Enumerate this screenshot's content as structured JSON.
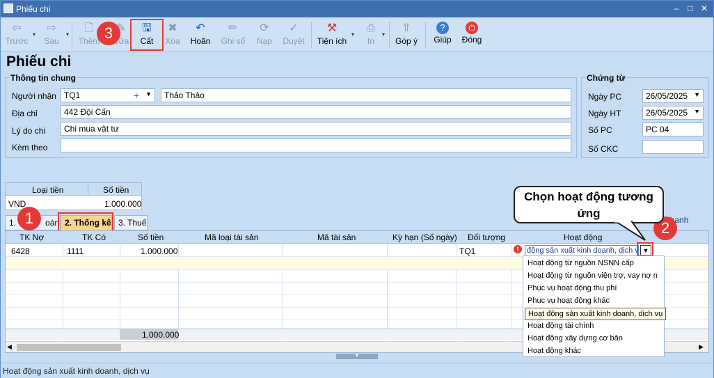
{
  "window": {
    "title": "Phiếu chi"
  },
  "toolbar": {
    "items": [
      {
        "label": "Trước",
        "icon": "arrow-left-icon",
        "glyph": "⇦"
      },
      {
        "label": "Sau",
        "icon": "arrow-right-icon",
        "glyph": "⇨"
      },
      {
        "label": "Thêm",
        "icon": "new-document-icon",
        "glyph": "🗋"
      },
      {
        "label": "Sửa",
        "icon": "edit-icon",
        "glyph": "✎"
      },
      {
        "label": "Cất",
        "icon": "save-icon",
        "glyph": "💾"
      },
      {
        "label": "Xóa",
        "icon": "delete-icon",
        "glyph": "✖"
      },
      {
        "label": "Hoãn",
        "icon": "undo-icon",
        "glyph": "↶"
      },
      {
        "label": "Ghi sổ",
        "icon": "pencil-icon",
        "glyph": "✏"
      },
      {
        "label": "Nạp",
        "icon": "refresh-icon",
        "glyph": "⟳"
      },
      {
        "label": "Duyệt",
        "icon": "check-icon",
        "glyph": "✓"
      },
      {
        "label": "Tiện ích",
        "icon": "tools-icon",
        "glyph": "⚒"
      },
      {
        "label": "In",
        "icon": "print-icon",
        "glyph": "⎙"
      },
      {
        "label": "Góp ý",
        "icon": "feedback-icon",
        "glyph": "⇧"
      },
      {
        "label": "Giúp",
        "icon": "help-icon",
        "glyph": "?"
      },
      {
        "label": "Đóng",
        "icon": "power-icon",
        "glyph": "⏻"
      }
    ]
  },
  "page_title": "Phiếu chi",
  "general_info": {
    "title": "Thông tin chung",
    "recipient_label": "Người nhận",
    "recipient_code": "TQ1",
    "recipient_name": "Thảo Thảo",
    "address_label": "Địa chỉ",
    "address": "442 Đội Cấn",
    "reason_label": "Lý do chi",
    "reason": "Chi mua vật tư",
    "attach_label": "Kèm theo",
    "attach": ""
  },
  "voucher": {
    "title": "Chứng từ",
    "pc_date_label": "Ngày PC",
    "pc_date": "26/05/2025",
    "ht_date_label": "Ngày HT",
    "ht_date": "26/05/2025",
    "pc_no_label": "Số PC",
    "pc_no": "PC  04",
    "ckc_no_label": "Số CKC",
    "ckc_no": ""
  },
  "currency_table": {
    "headers": [
      "Loại tiền",
      "Số tiền"
    ],
    "row": [
      "VND",
      "1.000.000"
    ]
  },
  "tabs": {
    "tab1": "1. Hạch toán",
    "tab1_visible": "1.",
    "tab1_rest": "oán",
    "tab2": "2. Thống kê",
    "tab3": "3. Thuế",
    "right_link": "nh",
    "right_link2": "nhanh"
  },
  "grid": {
    "headers": [
      "TK Nợ",
      "TK Có",
      "Số tiền",
      "Mã loại tài sản",
      "Mã tài sản",
      "Kỳ hạn (Số ngày)",
      "Đối tượng",
      "Hoạt động"
    ],
    "row1": {
      "tk_no": "6428",
      "tk_co": "1111",
      "amount": "1.000.000",
      "doi_tuong": "TQ1",
      "hoat_dong": "động sản xuất kinh doanh, dịch vụ"
    },
    "total": "1.000.000"
  },
  "dropdown": {
    "options": [
      "Hoạt động từ nguồn NSNN cấp",
      "Hoạt động từ nguồn viện trợ, vay nợ n",
      "Phục vụ hoạt động thu phí",
      "Phục vụ hoạt động khác",
      "Hoạt động sản xuất kinh doanh, dịch vụ",
      "Hoạt động tài chính",
      "Hoạt động xây dựng cơ bản",
      "Hoạt động khác"
    ],
    "selected_index": 4
  },
  "annotations": {
    "badge1": "1",
    "badge2": "2",
    "badge3": "3",
    "callout": "Chọn hoạt động tương ứng"
  },
  "status_bar": "Hoạt động sản xuất kinh doanh, dịch vụ",
  "colors": {
    "accent_red": "#e53935",
    "titlebar": "#3f6fb0",
    "panel": "#c6ddf4",
    "tab_active": "#f7d68c"
  }
}
